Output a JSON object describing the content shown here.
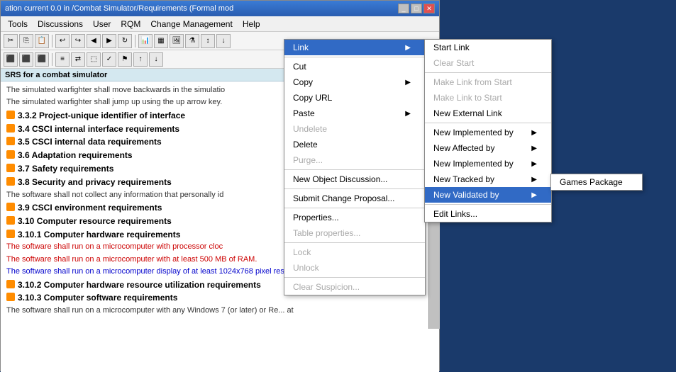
{
  "title": {
    "text": "ation current 0.0 in /Combat Simulator/Requirements (Formal mod"
  },
  "menu": {
    "items": [
      "Tools",
      "Discussions",
      "User",
      "RQM",
      "Change Management",
      "Help"
    ]
  },
  "section_header": {
    "text": "SRS for a combat simulator"
  },
  "doc_lines": [
    {
      "icon": "none",
      "text": "The simulated warfighter shall move backwards in the simulatio",
      "style": "normal"
    },
    {
      "icon": "none",
      "text": "The simulated warfighter shall jump up using the up arrow key.",
      "style": "normal"
    },
    {
      "icon": "orange",
      "text": "3.3.2 Project-unique identifier of interface",
      "style": "bold"
    },
    {
      "icon": "orange",
      "text": "3.4 CSCI internal interface requirements",
      "style": "bold"
    },
    {
      "icon": "orange",
      "text": "3.5 CSCI internal data requirements",
      "style": "bold"
    },
    {
      "icon": "orange",
      "text": "3.6 Adaptation requirements",
      "style": "bold"
    },
    {
      "icon": "orange",
      "text": "3.7 Safety requirements",
      "style": "bold"
    },
    {
      "icon": "orange",
      "text": "3.8 Security and privacy requirements",
      "style": "bold"
    },
    {
      "icon": "none",
      "text": "The software shall not collect any information that personally id",
      "style": "normal"
    },
    {
      "icon": "orange",
      "text": "3.9 CSCI environment requirements",
      "style": "bold"
    },
    {
      "icon": "orange",
      "text": "3.10 Computer resource requirements",
      "style": "bold"
    },
    {
      "icon": "orange",
      "text": "3.10.1 Computer hardware requirements",
      "style": "bold"
    },
    {
      "icon": "none",
      "text": "The software shall run on a microcomputer with processor cloc",
      "style": "red-text"
    },
    {
      "icon": "none",
      "text": "The software shall run on a microcomputer with at least 500 MB of RAM.",
      "style": "red-text"
    },
    {
      "icon": "none",
      "text": "The software shall run on a microcomputer display of at least 1024x768 pixel resolution.",
      "style": "blue-text"
    },
    {
      "icon": "orange",
      "text": "3.10.2 Computer hardware resource utilization requirements",
      "style": "bold"
    },
    {
      "icon": "orange",
      "text": "3.10.3 Computer software requirements",
      "style": "bold"
    },
    {
      "icon": "none",
      "text": "The software shall run on a microcomputer with any Windows 7 (or later) or Re...",
      "style": "normal"
    }
  ],
  "context_menu_main": {
    "items": [
      {
        "label": "Link",
        "arrow": true,
        "disabled": false,
        "highlighted": false
      },
      {
        "separator": true
      },
      {
        "label": "Cut",
        "disabled": false
      },
      {
        "label": "Copy",
        "arrow": true,
        "disabled": false
      },
      {
        "label": "Copy URL",
        "disabled": false
      },
      {
        "label": "Paste",
        "arrow": true,
        "disabled": false
      },
      {
        "label": "Undelete",
        "disabled": true
      },
      {
        "label": "Delete",
        "disabled": false
      },
      {
        "label": "Purge...",
        "disabled": true
      },
      {
        "separator": true
      },
      {
        "label": "New Object Discussion...",
        "disabled": false
      },
      {
        "separator": true
      },
      {
        "label": "Submit Change Proposal...",
        "disabled": false
      },
      {
        "separator": true
      },
      {
        "label": "Properties...",
        "disabled": false
      },
      {
        "label": "Table properties...",
        "disabled": true
      },
      {
        "separator": true
      },
      {
        "label": "Lock",
        "disabled": true
      },
      {
        "label": "Unlock",
        "disabled": true
      },
      {
        "separator": true
      },
      {
        "label": "Clear Suspicion...",
        "disabled": true
      }
    ]
  },
  "context_menu_link": {
    "items": [
      {
        "label": "Start Link",
        "disabled": false
      },
      {
        "label": "Clear Start",
        "disabled": true
      },
      {
        "separator": true
      },
      {
        "label": "Make Link from Start",
        "disabled": true
      },
      {
        "label": "Make Link to Start",
        "disabled": true
      },
      {
        "label": "New External Link",
        "disabled": false
      },
      {
        "separator": true
      },
      {
        "label": "New Implemented by",
        "arrow": true,
        "disabled": false
      },
      {
        "label": "New Affected by",
        "arrow": true,
        "disabled": false
      },
      {
        "label": "New Implemented by",
        "arrow": true,
        "disabled": false
      },
      {
        "label": "New Tracked by",
        "arrow": true,
        "disabled": false
      },
      {
        "label": "New Validated by",
        "arrow": true,
        "disabled": false,
        "highlighted": true
      },
      {
        "separator": true
      },
      {
        "label": "Edit Links...",
        "disabled": false
      }
    ]
  },
  "context_menu_validated": {
    "items": [
      {
        "label": "Games Package",
        "disabled": false
      }
    ]
  }
}
